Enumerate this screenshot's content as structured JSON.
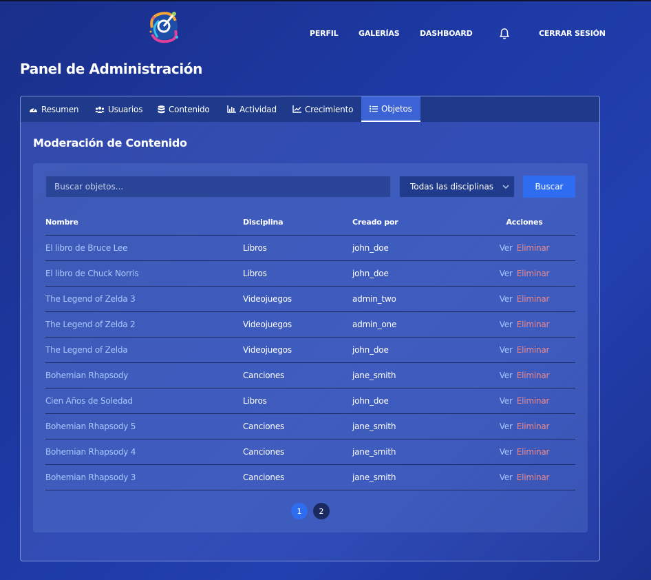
{
  "nav": {
    "items": [
      "PERFIL",
      "GALERÍAS",
      "DASHBOARD"
    ],
    "logout": "CERRAR SESIÓN"
  },
  "page": {
    "title": "Panel de Administración"
  },
  "tabs": [
    {
      "label": "Resumen",
      "icon": "gauge-icon"
    },
    {
      "label": "Usuarios",
      "icon": "users-icon"
    },
    {
      "label": "Contenido",
      "icon": "database-icon"
    },
    {
      "label": "Actividad",
      "icon": "bar-chart-icon"
    },
    {
      "label": "Crecimiento",
      "icon": "line-chart-icon"
    },
    {
      "label": "Objetos",
      "icon": "list-icon",
      "active": true
    }
  ],
  "moderation": {
    "title": "Moderación de Contenido",
    "search_placeholder": "Buscar objetos...",
    "filter_selected": "Todas las disciplinas",
    "search_button": "Buscar",
    "columns": [
      "Nombre",
      "Disciplina",
      "Creado por",
      "Acciones"
    ],
    "action_view": "Ver",
    "action_delete": "Eliminar",
    "rows": [
      {
        "name": "El libro de Bruce Lee",
        "discipline": "Libros",
        "creator": "john_doe"
      },
      {
        "name": "El libro de Chuck Norris",
        "discipline": "Libros",
        "creator": "john_doe"
      },
      {
        "name": "The Legend of Zelda 3",
        "discipline": "Videojuegos",
        "creator": "admin_two"
      },
      {
        "name": "The Legend of Zelda 2",
        "discipline": "Videojuegos",
        "creator": "admin_one"
      },
      {
        "name": "The Legend of Zelda",
        "discipline": "Videojuegos",
        "creator": "john_doe"
      },
      {
        "name": "Bohemian Rhapsody",
        "discipline": "Canciones",
        "creator": "jane_smith"
      },
      {
        "name": "Cien Años de Soledad",
        "discipline": "Libros",
        "creator": "john_doe"
      },
      {
        "name": "Bohemian Rhapsody 5",
        "discipline": "Canciones",
        "creator": "jane_smith"
      },
      {
        "name": "Bohemian Rhapsody 4",
        "discipline": "Canciones",
        "creator": "jane_smith"
      },
      {
        "name": "Bohemian Rhapsody 3",
        "discipline": "Canciones",
        "creator": "jane_smith"
      }
    ],
    "pages": [
      "1",
      "2"
    ],
    "current_page": "1"
  },
  "colors": {
    "accent": "#2e6df0",
    "link": "#a9c8ff",
    "danger": "#f08a8a"
  }
}
